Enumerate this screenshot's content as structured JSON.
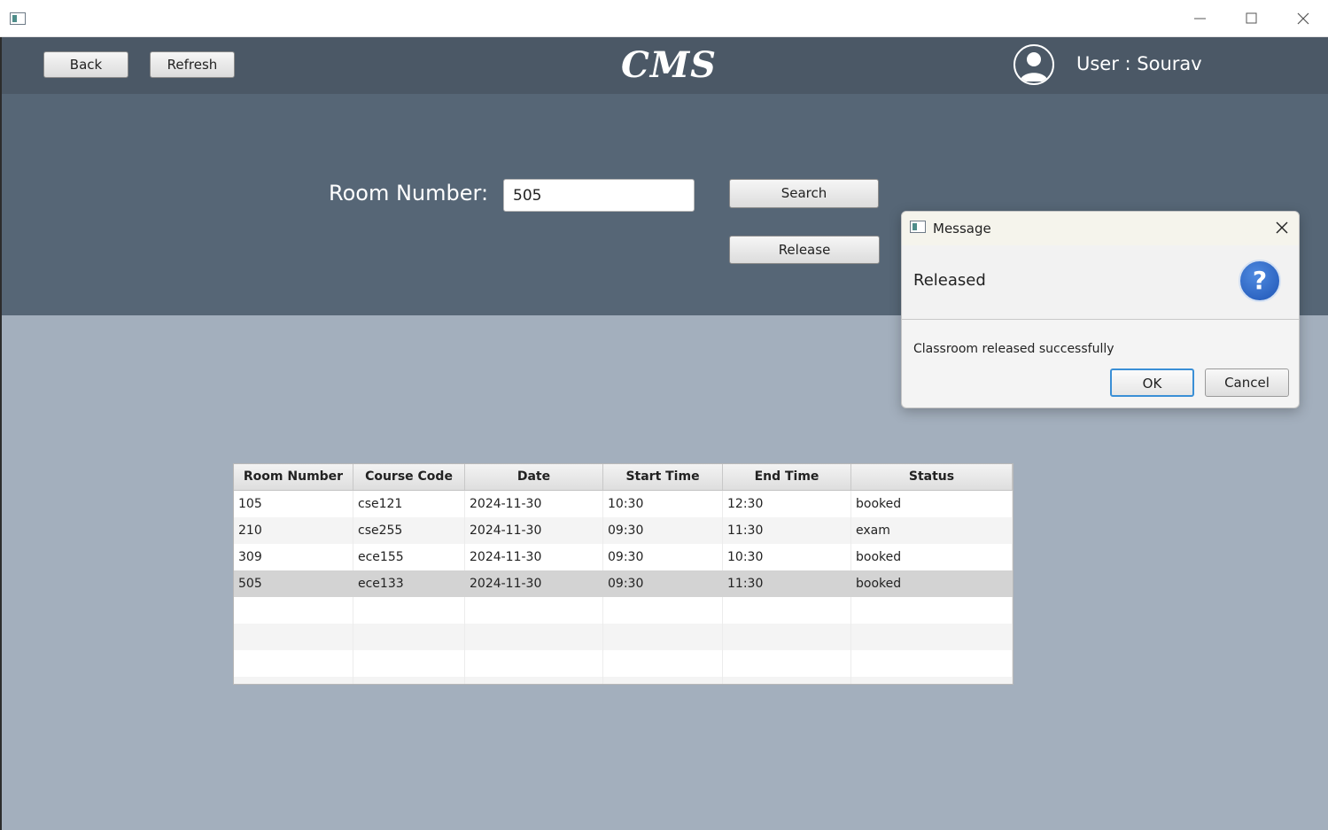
{
  "window": {
    "title": ""
  },
  "header": {
    "back_label": "Back",
    "refresh_label": "Refresh",
    "logo_text": "CMS",
    "user_text": "User : Sourav"
  },
  "search": {
    "room_label": "Room Number:",
    "room_value": "505",
    "search_label": "Search",
    "release_label": "Release"
  },
  "table": {
    "columns": [
      "Room Number",
      "Course Code",
      "Date",
      "Start Time",
      "End Time",
      "Status"
    ],
    "rows": [
      [
        "105",
        "cse121",
        "2024-11-30",
        "10:30",
        "12:30",
        "booked"
      ],
      [
        "210",
        "cse255",
        "2024-11-30",
        "09:30",
        "11:30",
        "exam"
      ],
      [
        "309",
        "ece155",
        "2024-11-30",
        "09:30",
        "10:30",
        "booked"
      ],
      [
        "505",
        "ece133",
        "2024-11-30",
        "09:30",
        "11:30",
        "booked"
      ]
    ],
    "selected_row": 3
  },
  "dialog": {
    "title": "Message",
    "heading": "Released",
    "content": "Classroom released successfully",
    "ok_label": "OK",
    "cancel_label": "Cancel",
    "icon": "question-icon"
  },
  "colors": {
    "header_bg": "#4b5866",
    "search_panel_bg": "#566676",
    "page_bg": "#a3afbd",
    "ok_border": "#3a8fd6"
  }
}
